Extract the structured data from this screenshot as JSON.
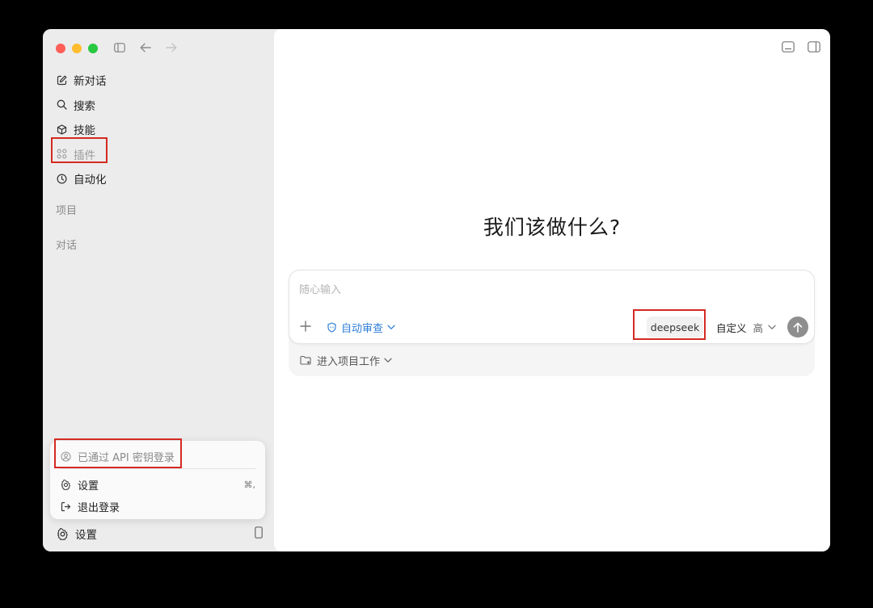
{
  "sidebar": {
    "nav": [
      {
        "label": "新对话",
        "icon": "edit-icon"
      },
      {
        "label": "搜索",
        "icon": "search-icon"
      },
      {
        "label": "技能",
        "icon": "cube-icon"
      },
      {
        "label": "插件",
        "icon": "grid-icon"
      },
      {
        "label": "自动化",
        "icon": "clock-icon"
      }
    ],
    "sections": {
      "projects": "项目",
      "conversations": "对话"
    }
  },
  "account_menu": {
    "status": "已通过 API 密钥登录",
    "settings_label": "设置",
    "settings_shortcut": "⌘,",
    "logout_label": "退出登录"
  },
  "bottom_bar": {
    "settings_label": "设置"
  },
  "main": {
    "headline": "我们该做什么?",
    "composer": {
      "placeholder": "随心输入",
      "review_label": "自动审查",
      "model": "deepseek",
      "mode_label": "自定义",
      "mode_level": "高",
      "project_label": "进入项目工作"
    }
  },
  "colors": {
    "accent": "#2f7fd9",
    "highlight": "#d42a22",
    "send": "#8e8e8e"
  }
}
